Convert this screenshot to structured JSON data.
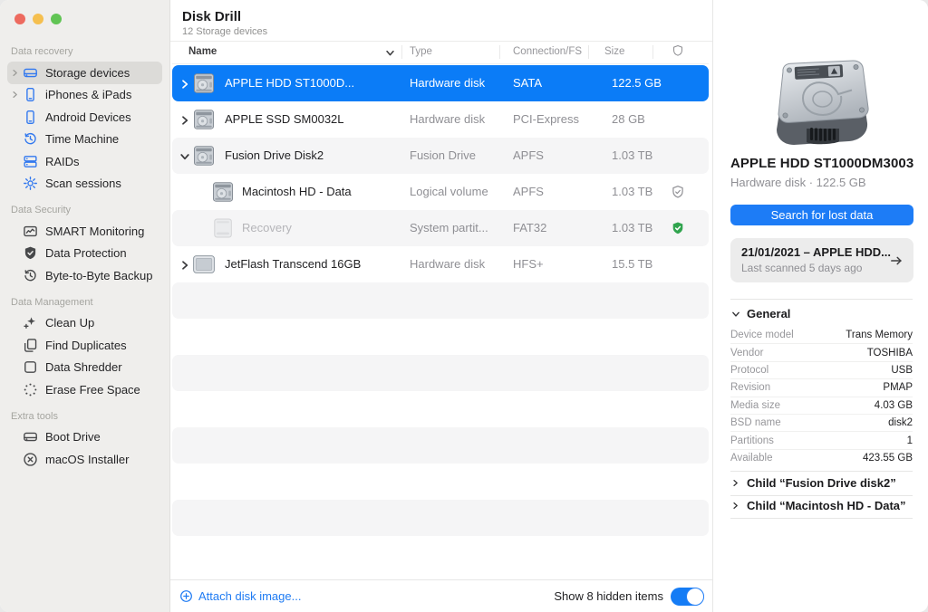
{
  "window": {
    "title": "Disk Drill",
    "subtitle": "12 Storage devices"
  },
  "colors": {
    "accent": "#157cf5",
    "selected_row": "#0b7cf7",
    "shield_green": "#30a44e",
    "sidebar_bg": "#efeeec",
    "stripe": "#f5f5f6"
  },
  "icons": {
    "top_right": "book-icon",
    "footer_link": "plus-circle-icon",
    "header_badge": "shield-icon"
  },
  "sidebar": {
    "sections": [
      {
        "label": "Data recovery",
        "items": [
          {
            "label": "Storage devices",
            "icon": "drive-icon",
            "selected": true,
            "chevron": true
          },
          {
            "label": "iPhones & iPads",
            "icon": "phone-icon",
            "chevron": true
          },
          {
            "label": "Android Devices",
            "icon": "phone-icon"
          },
          {
            "label": "Time Machine",
            "icon": "time-machine-icon"
          },
          {
            "label": "RAIDs",
            "icon": "raid-icon"
          },
          {
            "label": "Scan sessions",
            "icon": "gear-icon"
          }
        ]
      },
      {
        "label": "Data Security",
        "items": [
          {
            "label": "SMART Monitoring",
            "icon": "chart-icon"
          },
          {
            "label": "Data Protection",
            "icon": "shield-check-icon"
          },
          {
            "label": "Byte-to-Byte Backup",
            "icon": "history-icon"
          }
        ]
      },
      {
        "label": "Data Management",
        "items": [
          {
            "label": "Clean Up",
            "icon": "sparkle-icon"
          },
          {
            "label": "Find Duplicates",
            "icon": "duplicates-icon"
          },
          {
            "label": "Data Shredder",
            "icon": "square-icon"
          },
          {
            "label": "Erase Free Space",
            "icon": "dissolve-icon"
          }
        ]
      },
      {
        "label": "Extra tools",
        "items": [
          {
            "label": "Boot Drive",
            "icon": "drive-icon"
          },
          {
            "label": "macOS Installer",
            "icon": "circle-x-icon"
          }
        ]
      }
    ]
  },
  "table": {
    "headers": {
      "name": "Name",
      "type": "Type",
      "connection": "Connection/FS",
      "size": "Size"
    },
    "rows": [
      {
        "name": "APPLE HDD ST1000D...",
        "type": "Hardware disk",
        "connection": "SATA",
        "size": "122.5 GB",
        "icon": "hdd-icon",
        "chevron": "right",
        "selected": true
      },
      {
        "name": "APPLE SSD SM0032L",
        "type": "Hardware disk",
        "connection": "PCI-Express",
        "size": "28 GB",
        "icon": "hdd-icon",
        "chevron": "right"
      },
      {
        "name": "Fusion Drive Disk2",
        "type": "Fusion Drive",
        "connection": "APFS",
        "size": "1.03 TB",
        "icon": "hdd-icon",
        "chevron": "down",
        "striped": true
      },
      {
        "name": "Macintosh HD - Data",
        "type": "Logical volume",
        "connection": "APFS",
        "size": "1.03 TB",
        "icon": "hdd-icon",
        "indented": true,
        "badge": "shield-check-outline-icon"
      },
      {
        "name": "Recovery",
        "type": "System partit...",
        "connection": "FAT32",
        "size": "1.03 TB",
        "icon": "disk-muted-icon",
        "indented": true,
        "badge": "shield-check-green-icon",
        "muted": true,
        "striped": true
      },
      {
        "name": "JetFlash Transcend 16GB",
        "type": "Hardware disk",
        "connection": "HFS+",
        "size": "15.5 TB",
        "icon": "external-drive-icon",
        "chevron": "right"
      }
    ]
  },
  "footer": {
    "attach_label": "Attach disk image...",
    "hidden_label": "Show 8 hidden items",
    "toggle_on": true
  },
  "inspector": {
    "title": "APPLE HDD ST1000DM3003",
    "subtitle": "Hardware disk · 122.5 GB",
    "search_button": "Search for lost data",
    "scan_card": {
      "title": "21/01/2021 – APPLE HDD...",
      "subtitle": "Last scanned 5 days ago"
    },
    "general": {
      "label": "General",
      "rows": [
        {
          "label": "Device model",
          "value": "Trans Memory"
        },
        {
          "label": "Vendor",
          "value": "TOSHIBA"
        },
        {
          "label": "Protocol",
          "value": "USB"
        },
        {
          "label": "Revision",
          "value": "PMAP"
        },
        {
          "label": "Media size",
          "value": "4.03 GB"
        },
        {
          "label": "BSD name",
          "value": "disk2"
        },
        {
          "label": "Partitions",
          "value": "1"
        },
        {
          "label": "Available",
          "value": "423.55 GB"
        }
      ]
    },
    "children": [
      {
        "label": "Child “Fusion Drive disk2”"
      },
      {
        "label": "Child “Macintosh HD - Data”"
      }
    ]
  }
}
